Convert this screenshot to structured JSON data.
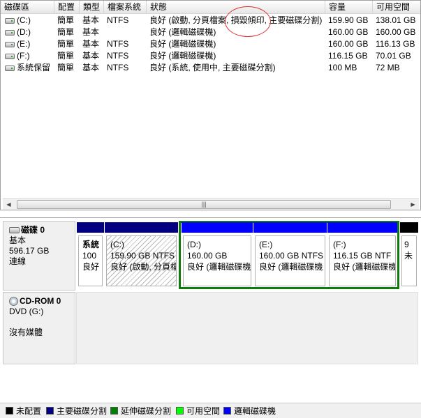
{
  "columns": [
    "磁碟區",
    "配置",
    "類型",
    "檔案系統",
    "狀態",
    "容量",
    "可用空間"
  ],
  "volumes": [
    {
      "name": "(C:)",
      "layout": "簡單",
      "type": "基本",
      "fs": "NTFS",
      "status": "良好 (啟動, 分頁檔案, 損毀傾印, 主要磁碟分割)",
      "capacity": "159.90 GB",
      "free": "138.01 GB"
    },
    {
      "name": "(D:)",
      "layout": "簡單",
      "type": "基本",
      "fs": "",
      "status": "良好 (邏輯磁碟機)",
      "capacity": "160.00 GB",
      "free": "160.00 GB"
    },
    {
      "name": "(E:)",
      "layout": "簡單",
      "type": "基本",
      "fs": "NTFS",
      "status": "良好 (邏輯磁碟機)",
      "capacity": "160.00 GB",
      "free": "116.13 GB"
    },
    {
      "name": "(F:)",
      "layout": "簡單",
      "type": "基本",
      "fs": "NTFS",
      "status": "良好 (邏輯磁碟機)",
      "capacity": "116.15 GB",
      "free": "70.01 GB"
    },
    {
      "name": "系統保留",
      "layout": "簡單",
      "type": "基本",
      "fs": "NTFS",
      "status": "良好 (系統, 使用中, 主要磁碟分割)",
      "capacity": "100 MB",
      "free": "72 MB"
    }
  ],
  "scrollbar": {
    "left_arrow": "◀",
    "right_arrow": "▶",
    "grip": "|||"
  },
  "disk0": {
    "title": "磁碟 0",
    "type": "基本",
    "size": "596.17 GB",
    "state": "連線",
    "partitions": [
      {
        "name": "系統",
        "size": "100",
        "status": "良好",
        "kind": "primary"
      },
      {
        "name": "(C:)",
        "size": "159.90 GB NTFS",
        "status": "良好 (啟動, 分頁檔",
        "kind": "primary-selected"
      },
      {
        "name": "(D:)",
        "size": "160.00 GB",
        "status": "良好 (邏輯磁碟機",
        "kind": "logical"
      },
      {
        "name": "(E:)",
        "size": "160.00 GB NTFS",
        "status": "良好 (邏輯磁碟機",
        "kind": "logical"
      },
      {
        "name": "(F:)",
        "size": "116.15 GB NTF",
        "status": "良好 (邏輯磁碟機",
        "kind": "logical"
      },
      {
        "name": "",
        "size": "9",
        "status": "未",
        "kind": "unallocated"
      }
    ]
  },
  "cdrom0": {
    "title": "CD-ROM 0",
    "drive": "DVD (G:)",
    "media": "沒有媒體"
  },
  "legend": [
    {
      "label": "未配置",
      "color": "#000000"
    },
    {
      "label": "主要磁碟分割",
      "color": "#000080"
    },
    {
      "label": "延伸磁碟分割",
      "color": "#008000"
    },
    {
      "label": "可用空間",
      "color": "#00ff00"
    },
    {
      "label": "邏輯磁碟機",
      "color": "#0000ff"
    }
  ]
}
